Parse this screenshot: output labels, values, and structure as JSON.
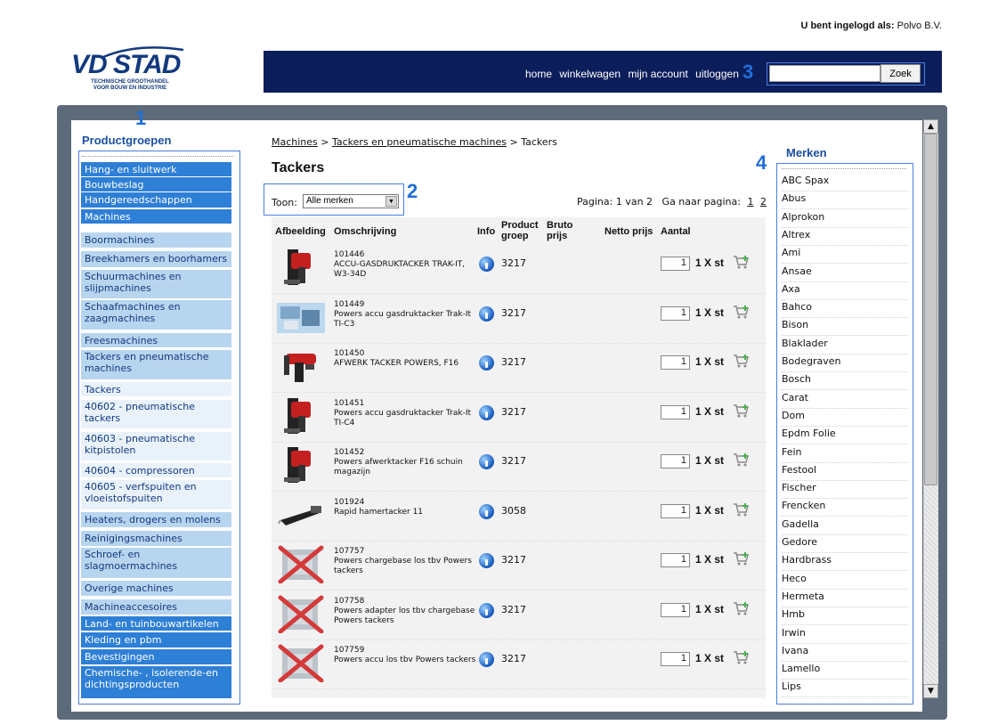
{
  "header": {
    "login_label": "U bent ingelogd als:",
    "login_user": "Polvo B.V.",
    "logo_text": "VD STAD",
    "logo_tagline": "TECHNISCHE GROOTHANDEL VOOR BOUW EN INDUSTRIE",
    "nav": [
      "home",
      "winkelwagen",
      "mijn account",
      "uitloggen"
    ],
    "search_placeholder": "",
    "search_button": "Zoek"
  },
  "annotations": [
    "1",
    "2",
    "3",
    "4"
  ],
  "sidebar": {
    "title": "Productgroepen",
    "items": [
      {
        "label": "Hang- en sluitwerk",
        "level": 1
      },
      {
        "label": "Bouwbeslag",
        "level": 1
      },
      {
        "label": "Handgereedschappen",
        "level": 1
      },
      {
        "label": "Machines",
        "level": 1
      },
      {
        "label": "Boormachines",
        "level": 2
      },
      {
        "label": "Breekhamers en boorhamers",
        "level": 2
      },
      {
        "label": "Schuurmachines en slijpmachines",
        "level": 2
      },
      {
        "label": "Schaafmachines en zaagmachines",
        "level": 2
      },
      {
        "label": "Freesmachines",
        "level": 2
      },
      {
        "label": "Tackers en pneumatische machines",
        "level": 2
      },
      {
        "label": "Tackers",
        "level": 3
      },
      {
        "label": "40602 - pneumatische tackers",
        "level": 3
      },
      {
        "label": "40603 - pneumatische kitpistolen",
        "level": 3
      },
      {
        "label": "40604 - compressoren",
        "level": 3
      },
      {
        "label": "40605 - verfspuiten en vloeistofspuiten",
        "level": 3
      },
      {
        "label": "Heaters, drogers en molens",
        "level": 2
      },
      {
        "label": "Reinigingsmachines",
        "level": 2
      },
      {
        "label": "Schroef- en slagmoermachines",
        "level": 2
      },
      {
        "label": "Overige machines",
        "level": 2
      },
      {
        "label": "Machineaccesoires",
        "level": 2
      },
      {
        "label": "Land- en tuinbouwartikelen",
        "level": 1
      },
      {
        "label": "Kleding en pbm",
        "level": 1
      },
      {
        "label": "Bevestigingen",
        "level": 1
      },
      {
        "label": "Chemische- , isolerende-en dichtingsproducten",
        "level": 1
      }
    ]
  },
  "breadcrumb": {
    "items": [
      "Machines",
      "Tackers en pneumatische machines",
      "Tackers"
    ],
    "separator": ">"
  },
  "main": {
    "title": "Tackers",
    "filter_label": "Toon:",
    "filter_value": "Alle merken",
    "pagination_text": "Pagina: 1 van 2",
    "goto_label": "Ga naar pagina:",
    "pages": [
      "1",
      "2"
    ],
    "columns": [
      "Afbeelding",
      "Omschrijving",
      "Info",
      "Product groep",
      "Bruto prijs",
      "Netto prijs",
      "Aantal"
    ],
    "unit_label": "1 X st",
    "products": [
      {
        "code": "101446",
        "description": "ACCU-GASDRUKTACKER TRAK-IT, W3-34D",
        "group": "3217",
        "qty": "1",
        "image": "red-nailer"
      },
      {
        "code": "101449",
        "description": "Powers accu gasdruktacker Trak-It TI-C3",
        "group": "3217",
        "qty": "1",
        "image": "kit-case"
      },
      {
        "code": "101450",
        "description": "AFWERK TACKER POWERS, F16",
        "group": "3217",
        "qty": "1",
        "image": "finish-nailer"
      },
      {
        "code": "101451",
        "description": "Powers accu gasdruktacker Trak-It TI-C4",
        "group": "3217",
        "qty": "1",
        "image": "red-nailer"
      },
      {
        "code": "101452",
        "description": "Powers afwerktacker F16 schuin magazijn",
        "group": "3217",
        "qty": "1",
        "image": "red-nailer"
      },
      {
        "code": "101924",
        "description": "Rapid hamertacker 11",
        "group": "3058",
        "qty": "1",
        "image": "hammer-tacker"
      },
      {
        "code": "107757",
        "description": "Powers chargebase los tbv Powers tackers",
        "group": "3217",
        "qty": "1",
        "image": "no-image"
      },
      {
        "code": "107758",
        "description": "Powers adapter los tbv chargebase Powers tackers",
        "group": "3217",
        "qty": "1",
        "image": "no-image"
      },
      {
        "code": "107759",
        "description": "Powers accu los tbv Powers tackers",
        "group": "3217",
        "qty": "1",
        "image": "no-image"
      }
    ]
  },
  "brands": {
    "title": "Merken",
    "items": [
      "ABC Spax",
      "Abus",
      "Alprokon",
      "Altrex",
      "Ami",
      "Ansae",
      "Axa",
      "Bahco",
      "Bison",
      "Blaklader",
      "Bodegraven",
      "Bosch",
      "Carat",
      "Dom",
      "Epdm Folie",
      "Fein",
      "Festool",
      "Fischer",
      "Frencken",
      "Gadella",
      "Gedore",
      "Hardbrass",
      "Heco",
      "Hermeta",
      "Hmb",
      "Irwin",
      "Ivana",
      "Lamello",
      "Lips"
    ]
  },
  "colors": {
    "navbar": "#0c1d5b",
    "category_l1": "#2e7fd6",
    "category_l2": "#b8d5ef",
    "category_l3": "#e9f2fb",
    "annotation": "#1f6fd8"
  }
}
